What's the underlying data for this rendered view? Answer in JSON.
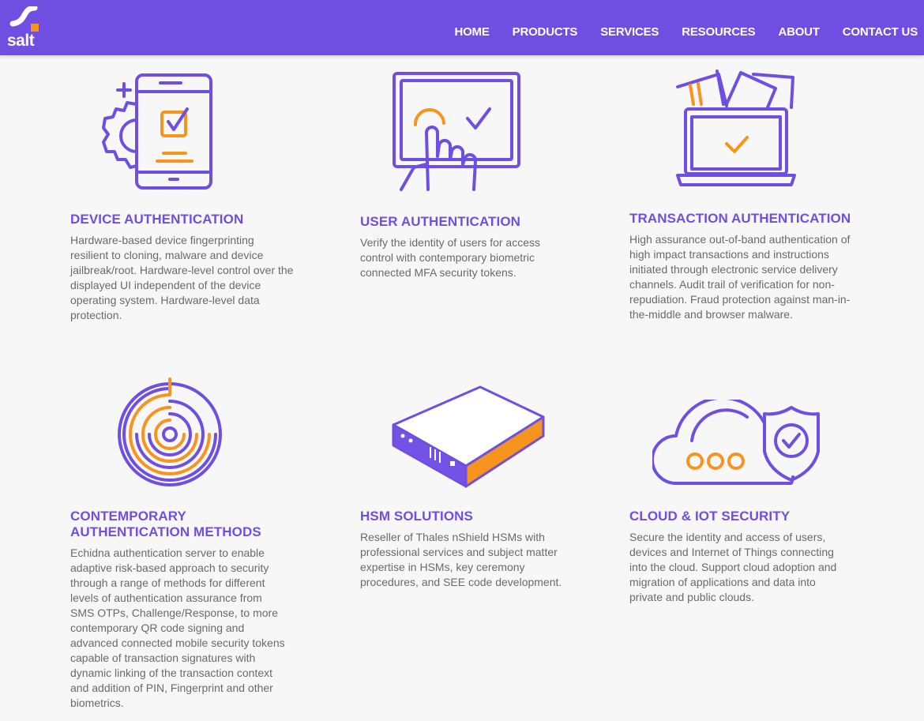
{
  "header": {
    "logo_text": "salt",
    "nav": [
      "HOME",
      "PRODUCTS",
      "SERVICES",
      "RESOURCES",
      "ABOUT",
      "CONTACT US"
    ]
  },
  "colors": {
    "brand_purple": "#6f4fe2",
    "accent_orange": "#f7941d",
    "body_text": "#6a6a6a"
  },
  "features": [
    {
      "icon": "mobile-device-check-icon",
      "title": "DEVICE AUTHENTICATION",
      "description": "Hardware-based device fingerprinting resilient to cloning, malware and device jailbreak/root. Hardware-level control over the displayed UI independent of the device operating system. Hardware-level data protection."
    },
    {
      "icon": "touchscreen-tap-icon",
      "title": "USER AUTHENTICATION",
      "description": "Verify the identity of users for access control with contemporary biometric connected MFA security tokens."
    },
    {
      "icon": "laptop-payment-icon",
      "title": "TRANSACTION AUTHENTICATION",
      "description": "High assurance out-of-band authentication of high impact transactions and instructions initiated through electronic service delivery channels. Audit trail of verification for non-repudiation. Fraud protection against man-in-the-middle and browser malware."
    },
    {
      "icon": "maze-icon",
      "title": "CONTEMPORARY AUTHENTICATION METHODS",
      "description": "Echidna authentication server to enable adaptive risk-based approach to security through a range of methods for different levels of authentication assurance from SMS OTPs, Challenge/Response, to more contemporary QR code signing and advanced connected mobile security tokens capable of transaction signatures with dynamic linking of the transaction context and addition of PIN, Fingerprint and other biometrics."
    },
    {
      "icon": "hsm-appliance-icon",
      "title": "HSM SOLUTIONS",
      "description": "Reseller of Thales nShield HSMs with professional services and subject matter expertise in HSMs, key ceremony procedures, and SEE code development."
    },
    {
      "icon": "cloud-shield-icon",
      "title": "CLOUD & IOT SECURITY",
      "description": "Secure the identity and access of users, devices and Internet of Things connecting into the cloud. Support cloud adoption and migration of applications and data into private and public clouds."
    }
  ]
}
